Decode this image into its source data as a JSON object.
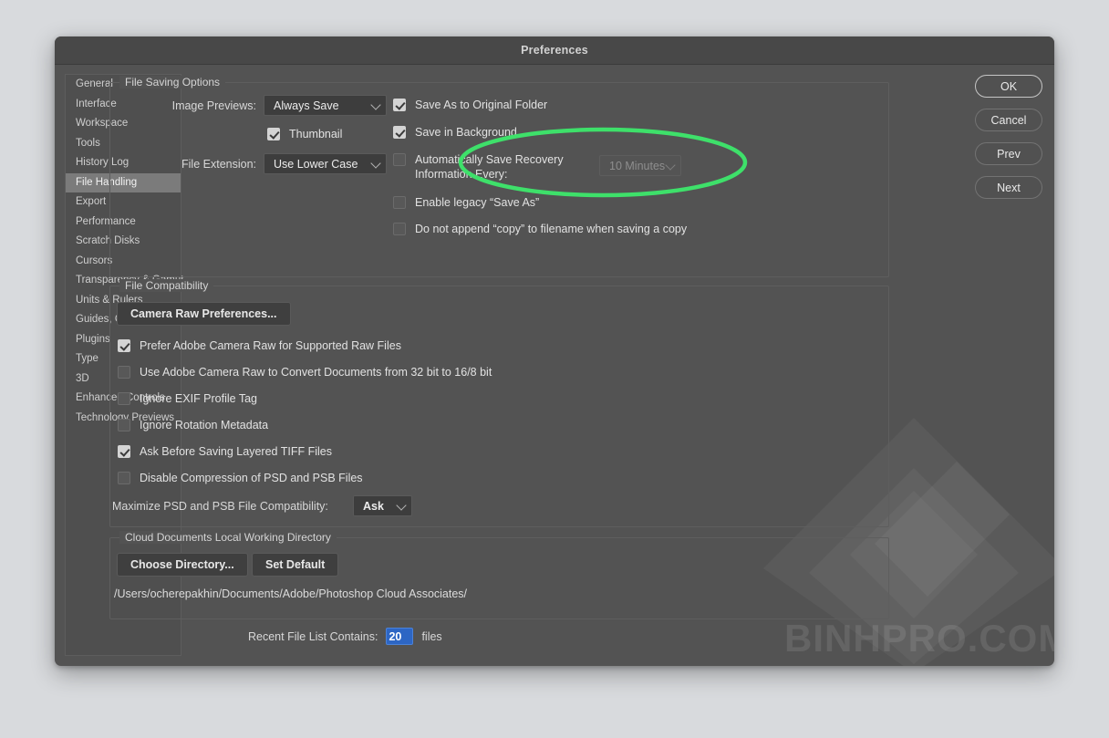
{
  "window": {
    "title": "Preferences"
  },
  "sidebar": {
    "items": [
      {
        "label": "General",
        "selected": false
      },
      {
        "label": "Interface",
        "selected": false
      },
      {
        "label": "Workspace",
        "selected": false
      },
      {
        "label": "Tools",
        "selected": false
      },
      {
        "label": "History Log",
        "selected": false
      },
      {
        "label": "File Handling",
        "selected": true
      },
      {
        "label": "Export",
        "selected": false
      },
      {
        "label": "Performance",
        "selected": false
      },
      {
        "label": "Scratch Disks",
        "selected": false
      },
      {
        "label": "Cursors",
        "selected": false
      },
      {
        "label": "Transparency & Gamut",
        "selected": false
      },
      {
        "label": "Units & Rulers",
        "selected": false
      },
      {
        "label": "Guides, Grid & Slices",
        "selected": false
      },
      {
        "label": "Plugins",
        "selected": false
      },
      {
        "label": "Type",
        "selected": false
      },
      {
        "label": "3D",
        "selected": false
      },
      {
        "label": "Enhanced Controls",
        "selected": false
      },
      {
        "label": "Technology Previews",
        "selected": false
      }
    ]
  },
  "buttons": {
    "ok": "OK",
    "cancel": "Cancel",
    "prev": "Prev",
    "next": "Next"
  },
  "file_saving": {
    "legend": "File Saving Options",
    "image_previews_label": "Image Previews:",
    "image_previews_value": "Always Save",
    "thumbnail_label": "Thumbnail",
    "thumbnail_checked": true,
    "file_extension_label": "File Extension:",
    "file_extension_value": "Use Lower Case",
    "save_as_original_label": "Save As to Original Folder",
    "save_as_original_checked": true,
    "save_background_label": "Save in Background",
    "save_background_checked": true,
    "autosave_label": "Automatically Save Recovery\nInformation Every:",
    "autosave_checked": false,
    "autosave_interval_value": "10 Minutes",
    "legacy_save_as_label": "Enable legacy “Save As”",
    "legacy_save_as_checked": false,
    "no_copy_suffix_label": "Do not append “copy” to filename when saving a copy",
    "no_copy_suffix_checked": false
  },
  "file_compatibility": {
    "legend": "File Compatibility",
    "camera_raw_button": "Camera Raw Preferences...",
    "options": [
      {
        "label": "Prefer Adobe Camera Raw for Supported Raw Files",
        "checked": true
      },
      {
        "label": "Use Adobe Camera Raw to Convert Documents from 32 bit to 16/8 bit",
        "checked": false
      },
      {
        "label": "Ignore EXIF Profile Tag",
        "checked": false
      },
      {
        "label": "Ignore Rotation Metadata",
        "checked": false
      },
      {
        "label": "Ask Before Saving Layered TIFF Files",
        "checked": true
      },
      {
        "label": "Disable Compression of PSD and PSB Files",
        "checked": false
      }
    ],
    "maximize_label": "Maximize PSD and PSB File Compatibility:",
    "maximize_value": "Ask"
  },
  "cloud_documents": {
    "legend": "Cloud Documents Local Working Directory",
    "choose_directory_button": "Choose Directory...",
    "set_default_button": "Set Default",
    "path": "/Users/ocherepakhin/Documents/Adobe/Photoshop Cloud Associates/"
  },
  "recent_files": {
    "label": "Recent File List Contains:",
    "value": "20",
    "suffix": "files"
  },
  "annotation": {
    "shape": "ellipse",
    "color": "#3ee06a",
    "target": "Automatically Save Recovery Information Every:"
  },
  "watermark": {
    "text": "BINHPRO.COM"
  },
  "colors": {
    "dialog_background": "#535353",
    "titlebar": "#484848",
    "sidebar": "#4f4f4f",
    "selected_item": "#7b7b7b",
    "control_background": "#3d3d3d",
    "accent_selection": "#2d66c4",
    "annotation_green": "#3ee06a"
  }
}
